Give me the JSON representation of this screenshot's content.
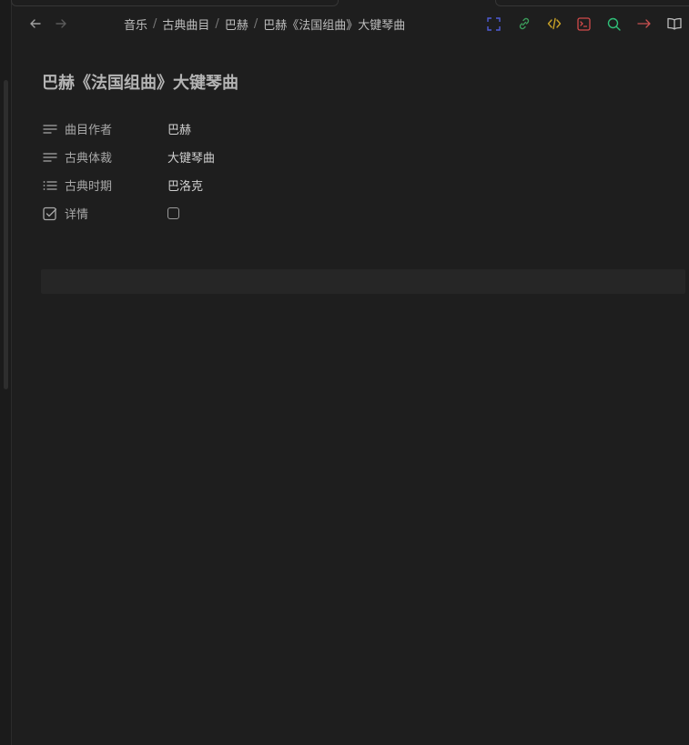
{
  "breadcrumb": {
    "items": [
      "音乐",
      "古典曲目",
      "巴赫",
      "巴赫《法国组曲》大键琴曲"
    ],
    "separator": "/"
  },
  "nav": {
    "back_icon": "arrow-left-icon",
    "forward_icon": "arrow-right-icon"
  },
  "toolbar": {
    "icons": [
      {
        "name": "fullscreen-icon",
        "color": "#4e5bd6"
      },
      {
        "name": "link-icon",
        "color": "#3b9b5a"
      },
      {
        "name": "code-icon",
        "color": "#c9a227"
      },
      {
        "name": "terminal-icon",
        "color": "#d24a4a"
      },
      {
        "name": "search-icon",
        "color": "#2fbf78"
      },
      {
        "name": "arrow-right-icon",
        "color": "#c85050"
      },
      {
        "name": "reading-mode-icon",
        "color": "#bdbdbd"
      }
    ]
  },
  "page": {
    "title": "巴赫《法国组曲》大键琴曲"
  },
  "properties": [
    {
      "key": "曲目作者",
      "value": "巴赫",
      "icon": "text-lines-icon"
    },
    {
      "key": "古典体裁",
      "value": "大键琴曲",
      "icon": "text-lines-icon"
    },
    {
      "key": "古典时期",
      "value": "巴洛克",
      "icon": "list-icon"
    },
    {
      "key": "详情",
      "value": "",
      "icon": "checkbox-icon",
      "checked": false
    }
  ]
}
